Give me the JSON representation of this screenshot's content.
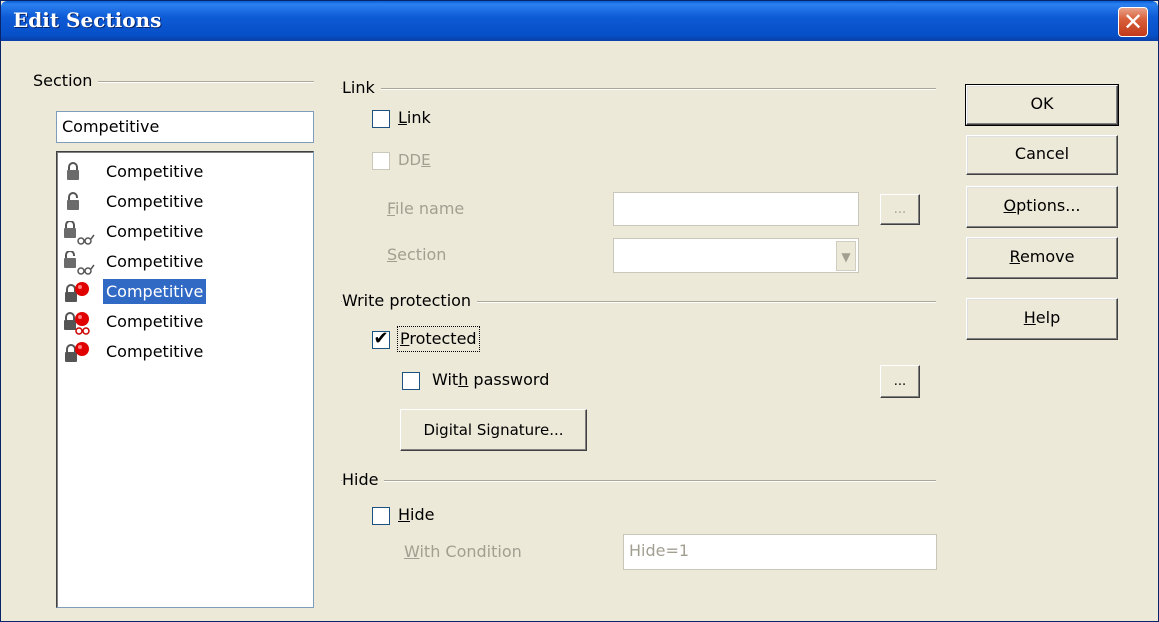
{
  "window": {
    "title": "Edit Sections",
    "close_label": "✕"
  },
  "section_panel": {
    "group_label": "Section",
    "name_value": "Competitive",
    "items": [
      {
        "label": "Competitive",
        "icon": "lock-closed-icon",
        "selected": false
      },
      {
        "label": "Competitive",
        "icon": "lock-open-icon",
        "selected": false
      },
      {
        "label": "Competitive",
        "icon": "lock-closed-link-icon",
        "selected": false
      },
      {
        "label": "Competitive",
        "icon": "lock-open-link-icon",
        "selected": false
      },
      {
        "label": "Competitive",
        "icon": "lock-hidden-icon",
        "selected": true
      },
      {
        "label": "Competitive",
        "icon": "lock-hidden-link-icon",
        "selected": false
      },
      {
        "label": "Competitive",
        "icon": "lock-hidden-icon",
        "selected": false
      }
    ]
  },
  "link_group": {
    "group_label": "Link",
    "link_checkbox": {
      "label_pre": "",
      "label_u": "L",
      "label_post": "ink",
      "checked": false
    },
    "dde_checkbox": {
      "label_pre": "DD",
      "label_u": "E",
      "label_post": "",
      "checked": false,
      "disabled": true
    },
    "file_name": {
      "label_pre": "",
      "label_u": "F",
      "label_post": "ile name",
      "value": ""
    },
    "browse_label": "...",
    "section": {
      "label_pre": "",
      "label_u": "S",
      "label_post": "ection",
      "value": ""
    }
  },
  "write_protection": {
    "group_label": "Write protection",
    "protected_checkbox": {
      "label_pre": "",
      "label_u": "P",
      "label_post": "rotected",
      "checked": true
    },
    "password_checkbox": {
      "label_pre": "Wit",
      "label_u": "h",
      "label_post": " password",
      "checked": false
    },
    "password_button_label": "...",
    "digital_signature_label": "Digital Signature..."
  },
  "hide_group": {
    "group_label": "Hide",
    "hide_checkbox": {
      "label_pre": "",
      "label_u": "H",
      "label_post": "ide",
      "checked": false
    },
    "condition": {
      "label_pre": "",
      "label_u": "W",
      "label_post": "ith Condition",
      "value": "Hide=1"
    }
  },
  "buttons": {
    "ok": "OK",
    "cancel": "Cancel",
    "options": {
      "pre": "",
      "u": "O",
      "post": "ptions..."
    },
    "remove": {
      "pre": "",
      "u": "R",
      "post": "emove"
    },
    "help": {
      "pre": "",
      "u": "H",
      "post": "elp"
    }
  },
  "colors": {
    "title_bar": "#0e5bd6",
    "dialog_bg": "#ece9d8",
    "selection": "#316ac5",
    "close_button": "#d9603a"
  }
}
